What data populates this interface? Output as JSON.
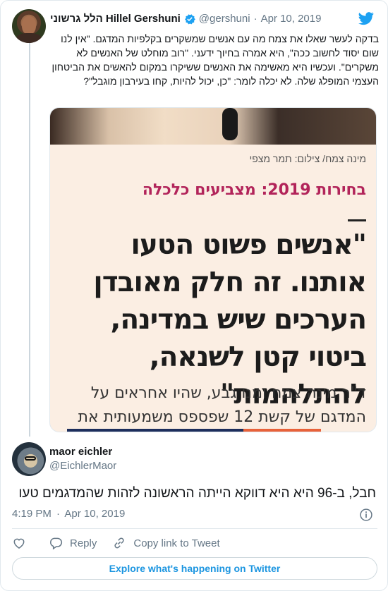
{
  "parent_tweet": {
    "author_name": "הלל גרשוני Hillel Gershuni",
    "handle": "@gershuni",
    "separator": "·",
    "date": "Apr 10, 2019",
    "text": "בדקה לעשר שאלו את צמח מה עם אנשים שמשקרים בקלפיות המדגם. \"אין לנו שום יסוד לחשוב ככה\", היא אמרה בחיוך ידעני. \"רוב מוחלט של האנשים לא משקרים\". ועכשיו היא מאשימה את האנשים ששיקרו במקום להאשים את הביטחון העצמי המופלג שלה. לא יכלה לומר: \"כן, יכול להיות, קחו בעירבון מוגבל\"?",
    "media": {
      "credit": "מינה צמח/ צילום: תמר מצפי",
      "kicker": "בחירות 2019: מצביעים כלכלה",
      "quote": "\"אנשים פשוט הטעו אותנו. זה חלק מאובדן הערכים שיש במדינה, ביטוי קטן לשנאה, להתלהמות\"",
      "byline": "ד\"ר מינה צמח ומנו גבע, שהיו אחראים על המדגם של קשת 12 שפספס משמעותית את"
    }
  },
  "reply_tweet": {
    "author_name": "maor eichler",
    "handle": "@EichlerMaor",
    "text": "חבל, ב-96 היא היא דווקא הייתה הראשונה לזהות שהמדגמים טעו",
    "time": "4:19 PM",
    "separator": "·",
    "date": "Apr 10, 2019"
  },
  "actions": {
    "reply_label": "Reply",
    "copy_link_label": "Copy link to Tweet"
  },
  "explore_label": "Explore what's happening on Twitter",
  "colors": {
    "accent": "#1b95e0",
    "verified": "#1da1f2",
    "muted_text": "#657786",
    "kicker": "#b2245a"
  },
  "icons": [
    "verified-badge-icon",
    "twitter-bird-icon",
    "info-icon",
    "heart-icon",
    "reply-icon",
    "link-icon"
  ]
}
